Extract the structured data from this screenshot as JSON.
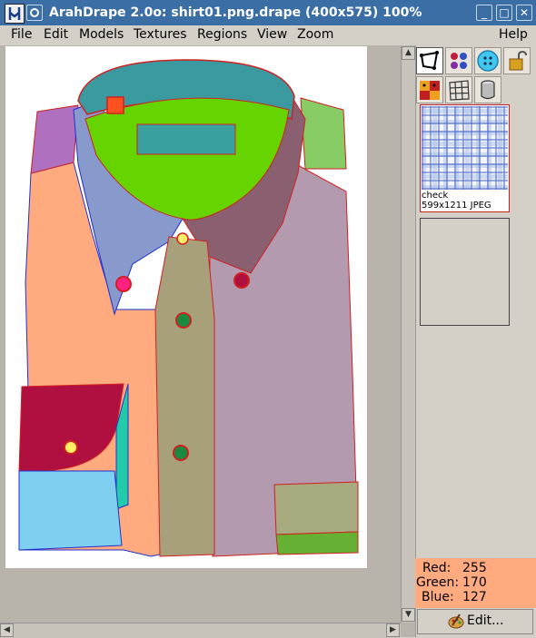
{
  "window": {
    "title": "ArahDrape 2.0o: shirt01.png.drape (400x575) 100%",
    "minimize_glyph": "_",
    "maximize_glyph": "□",
    "close_glyph": "✕"
  },
  "menu": {
    "file": "File",
    "edit": "Edit",
    "models": "Models",
    "textures": "Textures",
    "regions": "Regions",
    "view": "View",
    "zoom": "Zoom",
    "help": "Help"
  },
  "tools": [
    {
      "icon": "region-select-icon"
    },
    {
      "icon": "palette-dots-icon"
    },
    {
      "icon": "button-icon"
    },
    {
      "icon": "lock-icon"
    },
    {
      "icon": "masks-icon"
    },
    {
      "icon": "mesh-grid-icon"
    },
    {
      "icon": "cylinder-icon"
    }
  ],
  "texture": {
    "name": "check",
    "info": "599x1211 JPEG"
  },
  "color": {
    "red_label": "Red:",
    "red_value": "255",
    "green_label": "Green:",
    "green_value": "170",
    "blue_label": "Blue:",
    "blue_value": "127",
    "swatch": "#ffaa7f"
  },
  "edit_button": {
    "label": "Edit..."
  }
}
